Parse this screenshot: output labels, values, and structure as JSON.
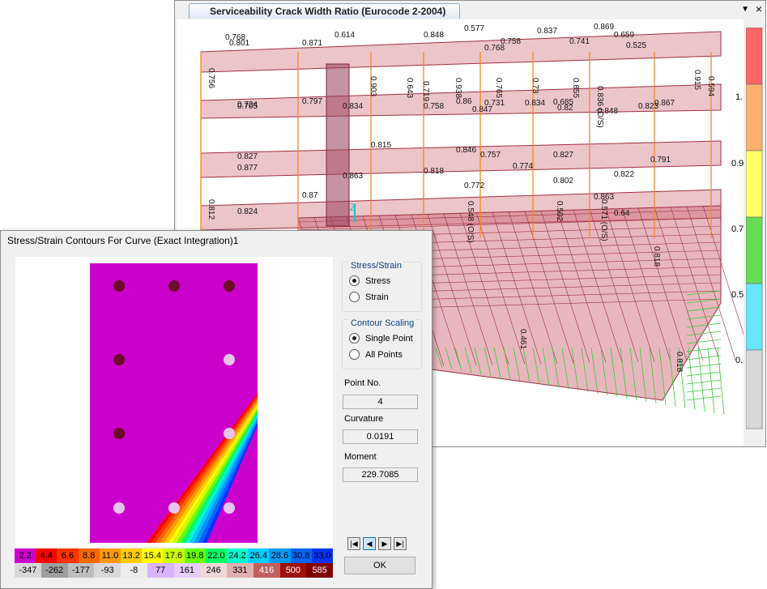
{
  "window3d": {
    "tab_title": "Serviceability Crack Width Ratio  (Eurocode 2-2004)",
    "legend_labels": [
      "1.",
      "0.9",
      "0.7",
      "0.5",
      "0."
    ],
    "legend_colors": [
      "#ff6666",
      "#ffb070",
      "#ffff66",
      "#66dd55",
      "#66e6ff",
      "#d8d8d8"
    ],
    "axis_label": "Z",
    "labels": [
      {
        "t": "0.768"
      },
      {
        "t": "0.801"
      },
      {
        "t": "0.871"
      },
      {
        "t": "0.614"
      },
      {
        "t": "0.848"
      },
      {
        "t": "0.577"
      },
      {
        "t": "0.837"
      },
      {
        "t": "0.869"
      },
      {
        "t": "0.659"
      },
      {
        "t": "0.758"
      },
      {
        "t": "0.741"
      },
      {
        "t": "0.768"
      },
      {
        "t": "0.525"
      },
      {
        "t": "0.756"
      },
      {
        "t": "0.903"
      },
      {
        "t": "0.643"
      },
      {
        "t": "0.719"
      },
      {
        "t": "0.938"
      },
      {
        "t": "0.765"
      },
      {
        "t": "0.73"
      },
      {
        "t": "0.855"
      },
      {
        "t": "0.836 (O/S)"
      },
      {
        "t": "0.915"
      },
      {
        "t": "0.594"
      },
      {
        "t": "0.797"
      },
      {
        "t": "0.834"
      },
      {
        "t": "0.758"
      },
      {
        "t": "0.86"
      },
      {
        "t": "0.731"
      },
      {
        "t": "0.847"
      },
      {
        "t": "0.834"
      },
      {
        "t": "0.685"
      },
      {
        "t": "0.82"
      },
      {
        "t": "0.848"
      },
      {
        "t": "0.823"
      },
      {
        "t": "0.867"
      },
      {
        "t": "0.724"
      },
      {
        "t": "0.705"
      },
      {
        "t": "0.827"
      },
      {
        "t": "0.877"
      },
      {
        "t": "0.815"
      },
      {
        "t": "0.846"
      },
      {
        "t": "0.757"
      },
      {
        "t": "0.774"
      },
      {
        "t": "0.827"
      },
      {
        "t": "0.791"
      },
      {
        "t": "0.822"
      },
      {
        "t": "0.863"
      },
      {
        "t": "0.818"
      },
      {
        "t": "0.772"
      },
      {
        "t": "0.802"
      },
      {
        "t": "0.863"
      },
      {
        "t": "0.812"
      },
      {
        "t": "0.824"
      },
      {
        "t": "0.87"
      },
      {
        "t": "0.64"
      },
      {
        "t": "0.548 (O/S)"
      },
      {
        "t": "0.571 (O/S)"
      },
      {
        "t": "0.502"
      },
      {
        "t": "0.818"
      },
      {
        "t": "0.461"
      },
      {
        "t": "0.818"
      }
    ]
  },
  "dialog": {
    "title": "Stress/Strain Contours For Curve (Exact Integration)1",
    "stress_strain_group": "Stress/Strain",
    "stress_label": "Stress",
    "strain_label": "Strain",
    "contour_group": "Contour Scaling",
    "single_point_label": "Single Point",
    "all_points_label": "All Points",
    "point_no_label": "Point No.",
    "point_no_value": "4",
    "curvature_label": "Curvature",
    "curvature_value": "0.0191",
    "moment_label": "Moment",
    "moment_value": "229.7085",
    "ok_label": "OK",
    "nav": [
      "first",
      "prev",
      "next",
      "last"
    ],
    "scale_top": {
      "values": [
        "2.2",
        "4.4",
        "6.6",
        "8.8",
        "11.0",
        "13.2",
        "15.4",
        "17.6",
        "19.8",
        "22.0",
        "24.2",
        "26.4",
        "28.6",
        "30.8",
        "33.0"
      ],
      "colors": [
        "#cc00cc",
        "#ff0000",
        "#ff3300",
        "#ff6600",
        "#ff9900",
        "#ffcc00",
        "#ffff00",
        "#ccff00",
        "#66ff00",
        "#00ff66",
        "#00ffcc",
        "#00ccff",
        "#0099ff",
        "#0066ff",
        "#0033ff"
      ]
    },
    "scale_bottom": {
      "values": [
        "-347",
        "-262",
        "-177",
        "-93",
        "-8",
        "77",
        "161",
        "246",
        "331",
        "416",
        "500",
        "585"
      ],
      "colors": [
        "#d8d8d8",
        "#9e9e9e",
        "#bdbdbd",
        "#d9d9d9",
        "#ececec",
        "#d9b3ff",
        "#e6ccff",
        "#f0d8d8",
        "#e0b0b0",
        "#c06060",
        "#a01010",
        "#800000"
      ]
    },
    "section_color": "#cc00cc",
    "bar_dark_color": "#6b0a2a",
    "bar_light_color": "#e7c3ee"
  }
}
